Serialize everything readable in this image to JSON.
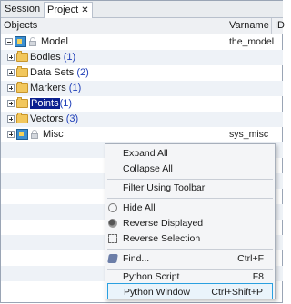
{
  "tabs": [
    {
      "label": "Session"
    },
    {
      "label": "Project",
      "close": "✕"
    }
  ],
  "columns": {
    "objects": "Objects",
    "varname": "Varname",
    "id": "ID"
  },
  "tree": {
    "model": {
      "label": "Model",
      "varname": "the_model"
    },
    "items": [
      {
        "label": "Bodies",
        "count": "(1)"
      },
      {
        "label": "Data Sets",
        "count": "(2)"
      },
      {
        "label": "Markers",
        "count": "(1)"
      },
      {
        "label": "Points",
        "count": "(1)"
      },
      {
        "label": "Vectors",
        "count": "(3)"
      }
    ],
    "misc": {
      "label": "Misc",
      "varname": "sys_misc"
    }
  },
  "menu": {
    "expand_all": "Expand All",
    "collapse_all": "Collapse All",
    "filter": "Filter Using Toolbar",
    "hide_all": "Hide All",
    "reverse_displayed": "Reverse Displayed",
    "reverse_selection": "Reverse Selection",
    "find": "Find...",
    "find_shortcut": "Ctrl+F",
    "python_script": "Python Script",
    "python_script_shortcut": "F8",
    "python_window": "Python Window",
    "python_window_shortcut": "Ctrl+Shift+P"
  },
  "colors": {
    "selection": "#0a1f8f",
    "count_text": "#1f3fb8",
    "highlight_border": "#2aa0e0"
  }
}
